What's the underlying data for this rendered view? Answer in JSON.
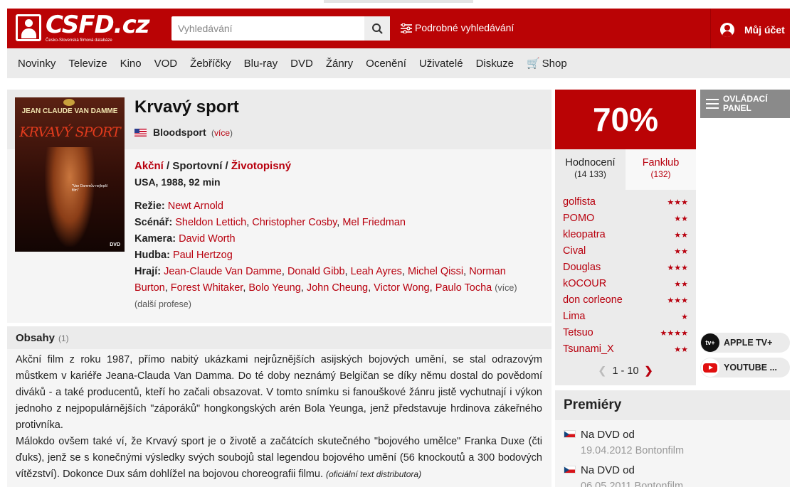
{
  "header": {
    "logo_text": "CSFD.cz",
    "logo_subtitle": "Česko-Slovenská filmová databáze",
    "search_placeholder": "Vyhledávání",
    "advanced_search": "Podrobné vyhledávání",
    "account": "Můj účet"
  },
  "nav": {
    "items": [
      "Novinky",
      "Televize",
      "Kino",
      "VOD",
      "Žebříčky",
      "Blu-ray",
      "DVD",
      "Žánry",
      "Ocenění",
      "Uživatelé",
      "Diskuze",
      "Shop"
    ]
  },
  "film": {
    "title": "Krvavý sport",
    "original_title": "Bloodsport",
    "original_more": "(více)",
    "genres": [
      "Akční",
      "Sportovní",
      "Životopisný"
    ],
    "origin": "USA, 1988, 92 min",
    "poster": {
      "actor": "JEAN CLAUDE VAN DAMME",
      "title": "KRVAVÝ SPORT",
      "quote": "\"Van Dammův nejlepší film\"",
      "badge": "DVD"
    },
    "creators": {
      "directing_label": "Režie:",
      "directors": [
        "Newt Arnold"
      ],
      "screenplay_label": "Scénář:",
      "screenplay": [
        "Sheldon Lettich",
        "Christopher Cosby",
        "Mel Friedman"
      ],
      "camera_label": "Kamera:",
      "camera": [
        "David Worth"
      ],
      "music_label": "Hudba:",
      "music": [
        "Paul Hertzog"
      ],
      "cast_label": "Hrají:",
      "cast": [
        "Jean-Claude Van Damme",
        "Donald Gibb",
        "Leah Ayres",
        "Michel Qissi",
        "Norman Burton",
        "Forest Whitaker",
        "Bolo Yeung",
        "John Cheung",
        "Victor Wong",
        "Paulo Tocha"
      ],
      "cast_more": "(více)",
      "more_professions": "(další profese)"
    }
  },
  "plot": {
    "title": "Obsahy",
    "count": "(1)",
    "paragraph1": "Akční film z roku 1987, přímo nabitý ukázkami nejrůznějších asijských bojových umění, se stal odrazovým můstkem v kariéře Jeana-Clauda Van Damma. Do té doby neznámý Belgičan se díky němu dostal do povědomí diváků - a také producentů, kteří ho začali obsazovat. V tomto snímku si fanouškové žánru jistě vychutnají i výkon jednoho z nejpopulárnějších \"záporáků\" hongkongských arén Bola Yeunga, jenž představuje hrdinova zákeřného protivníka.",
    "paragraph2": "Málokdo ovšem také ví, že Krvavý sport je o životě a začátcích skutečného \"bojového umělce\" Franka Duxe (čti ďuks), jenž se s konečnými výsledky svých soubojů stal legendou bojového umění (56 knockoutů a 300 bodových vítězství). Dokonce Dux sám dohlížel na bojovou choreografii filmu.",
    "source": "(oficiální text distributora)"
  },
  "rating": {
    "percent": "70%",
    "tab_active_label": "Hodnocení",
    "tab_active_count": "(14 133)",
    "tab_fanclub_label": "Fanklub",
    "tab_fanclub_count": "(132)",
    "users": [
      {
        "name": "golfista",
        "stars": 3,
        "stars_text": "★★★"
      },
      {
        "name": "POMO",
        "stars": 2,
        "stars_text": "★★"
      },
      {
        "name": "kleopatra",
        "stars": 2,
        "stars_text": "★★"
      },
      {
        "name": "Cival",
        "stars": 2,
        "stars_text": "★★"
      },
      {
        "name": "Douglas",
        "stars": 3,
        "stars_text": "★★★"
      },
      {
        "name": "kOCOUR",
        "stars": 2,
        "stars_text": "★★"
      },
      {
        "name": "don corleone",
        "stars": 3,
        "stars_text": "★★★"
      },
      {
        "name": "Lima",
        "stars": 1,
        "stars_text": "★"
      },
      {
        "name": "Tetsuo",
        "stars": 4,
        "stars_text": "★★★★"
      },
      {
        "name": "Tsunami_X",
        "stars": 2,
        "stars_text": "★★"
      }
    ],
    "pager": "1 - 10"
  },
  "side": {
    "panel_line1": "OVLÁDACÍ",
    "panel_line2": "PANEL",
    "apple_icon_text": "tv+",
    "apple": "APPLE TV+",
    "youtube": "YOUTUBE ..."
  },
  "premiery": {
    "title": "Premiéry",
    "items": [
      {
        "label": "Na DVD od",
        "date": "19.04.2012 Bontonfilm"
      },
      {
        "label": "Na DVD od",
        "date": "06.05.2011 Bontonfilm"
      }
    ]
  },
  "colors": {
    "brand_red": "#ba0305",
    "link_red": "#b8000e",
    "panel_gray": "#ebebeb"
  }
}
